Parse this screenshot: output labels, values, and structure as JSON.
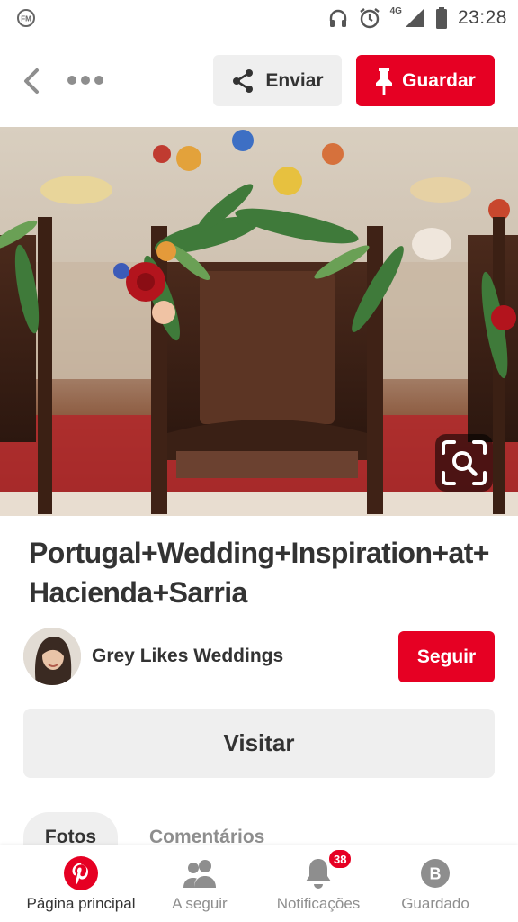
{
  "status_bar": {
    "network": "4G",
    "time": "23:28"
  },
  "toolbar": {
    "share_label": "Enviar",
    "save_label": "Guardar"
  },
  "pin": {
    "title": "Portugal+Wedding+Inspiration+at+Hacienda+Sarria"
  },
  "creator": {
    "name": "Grey Likes Weddings",
    "follow_label": "Seguir"
  },
  "visit_label": "Visitar",
  "tabs": [
    {
      "label": "Fotos",
      "active": true
    },
    {
      "label": "Comentários",
      "active": false
    }
  ],
  "bottom_nav": [
    {
      "label": "Página principal",
      "icon": "pinterest-logo-icon",
      "active": true
    },
    {
      "label": "A seguir",
      "icon": "people-icon",
      "active": false
    },
    {
      "label": "Notificações",
      "icon": "bell-icon",
      "active": false,
      "badge": "38"
    },
    {
      "label": "Guardado",
      "icon": "profile-initial-icon",
      "initial": "B",
      "active": false
    }
  ],
  "colors": {
    "brand_red": "#e60023",
    "button_gray": "#efefef",
    "text_dark": "#333333",
    "text_muted": "#8e8e8e"
  }
}
